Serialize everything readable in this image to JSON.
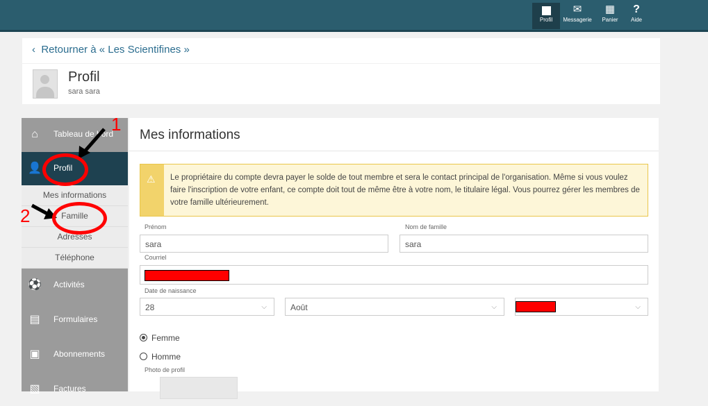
{
  "topnav": {
    "items": [
      {
        "label": "Profil",
        "icon": "profile-square-icon"
      },
      {
        "label": "Messagerie",
        "icon": "envelope-icon"
      },
      {
        "label": "Panier",
        "icon": "basket-icon"
      },
      {
        "label": "Aide",
        "icon": "question-icon"
      }
    ]
  },
  "back": {
    "label": "Retourner à « Les Scientifines »"
  },
  "profile": {
    "title": "Profil",
    "user": "sara sara"
  },
  "sidebar": {
    "items": [
      {
        "label": "Tableau de bord",
        "icon": "home-icon"
      },
      {
        "label": "Profil",
        "icon": "user-icon"
      },
      {
        "label": "Activités",
        "icon": "soccer-ball-icon"
      },
      {
        "label": "Formulaires",
        "icon": "form-icon"
      },
      {
        "label": "Abonnements",
        "icon": "card-icon"
      },
      {
        "label": "Factures",
        "icon": "invoice-icon"
      }
    ],
    "subitems": [
      "Mes informations",
      "Famille",
      "Adresses",
      "Téléphone"
    ]
  },
  "main": {
    "title": "Mes informations",
    "alert": "Le propriétaire du compte devra payer le solde de tout membre et sera le contact principal de l'organisation. Même si vous voulez faire l'inscription de votre enfant, ce compte doit tout de même être à votre nom, le titulaire légal. Vous pourrez gérer les membres de votre famille ultérieurement.",
    "form": {
      "first_name_label": "Prénom",
      "first_name": "sara",
      "last_name_label": "Nom de famille",
      "last_name": "sara",
      "email_label": "Courriel",
      "birth_label": "Date de naissance",
      "birth_day": "28",
      "birth_month": "Août",
      "gender_female": "Femme",
      "gender_male": "Homme",
      "photo_label": "Photo de profil"
    }
  },
  "annotations": {
    "step1": "1",
    "step2": "2"
  },
  "colors": {
    "topbar": "#2b5d6e",
    "sidebar_active": "#1e4150",
    "annotation": "#ff0000",
    "alert": "#fdf6d8"
  }
}
